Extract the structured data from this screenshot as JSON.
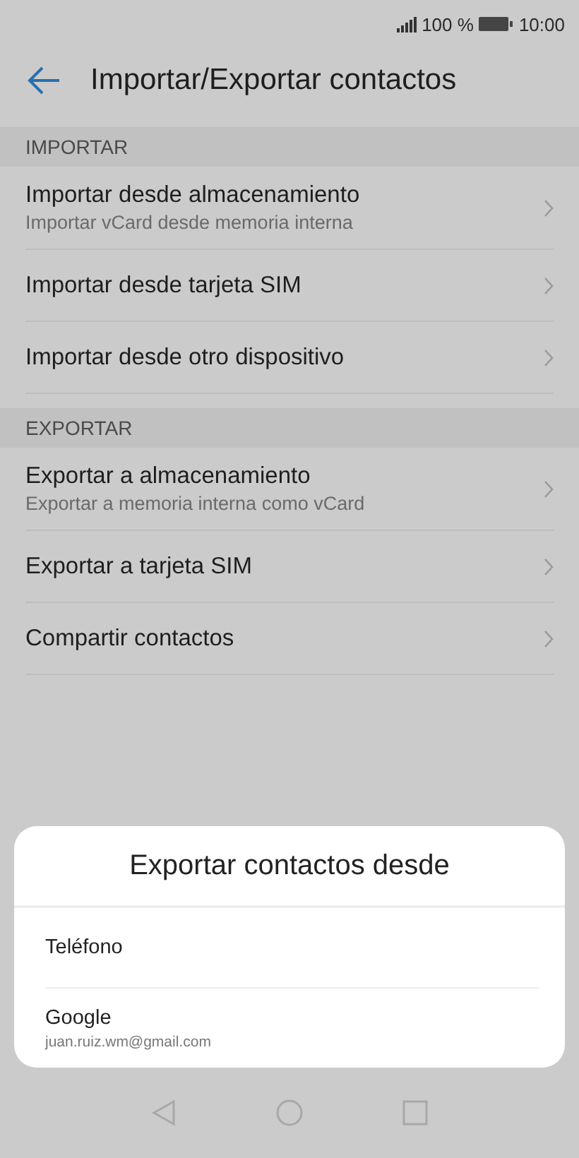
{
  "status_bar": {
    "battery": "100 %",
    "time": "10:00"
  },
  "header": {
    "title": "Importar/Exportar contactos"
  },
  "sections": [
    {
      "title": "IMPORTAR",
      "items": [
        {
          "title": "Importar desde almacenamiento",
          "subtitle": "Importar vCard desde memoria interna"
        },
        {
          "title": "Importar desde tarjeta SIM"
        },
        {
          "title": "Importar desde otro dispositivo"
        }
      ]
    },
    {
      "title": "EXPORTAR",
      "items": [
        {
          "title": "Exportar a almacenamiento",
          "subtitle": "Exportar a memoria interna como vCard"
        },
        {
          "title": "Exportar a tarjeta SIM"
        },
        {
          "title": "Compartir contactos"
        }
      ]
    }
  ],
  "dialog": {
    "title": "Exportar contactos desde",
    "options": [
      {
        "label": "Teléfono"
      },
      {
        "label": "Google",
        "subtitle": "juan.ruiz.wm@gmail.com"
      }
    ]
  }
}
